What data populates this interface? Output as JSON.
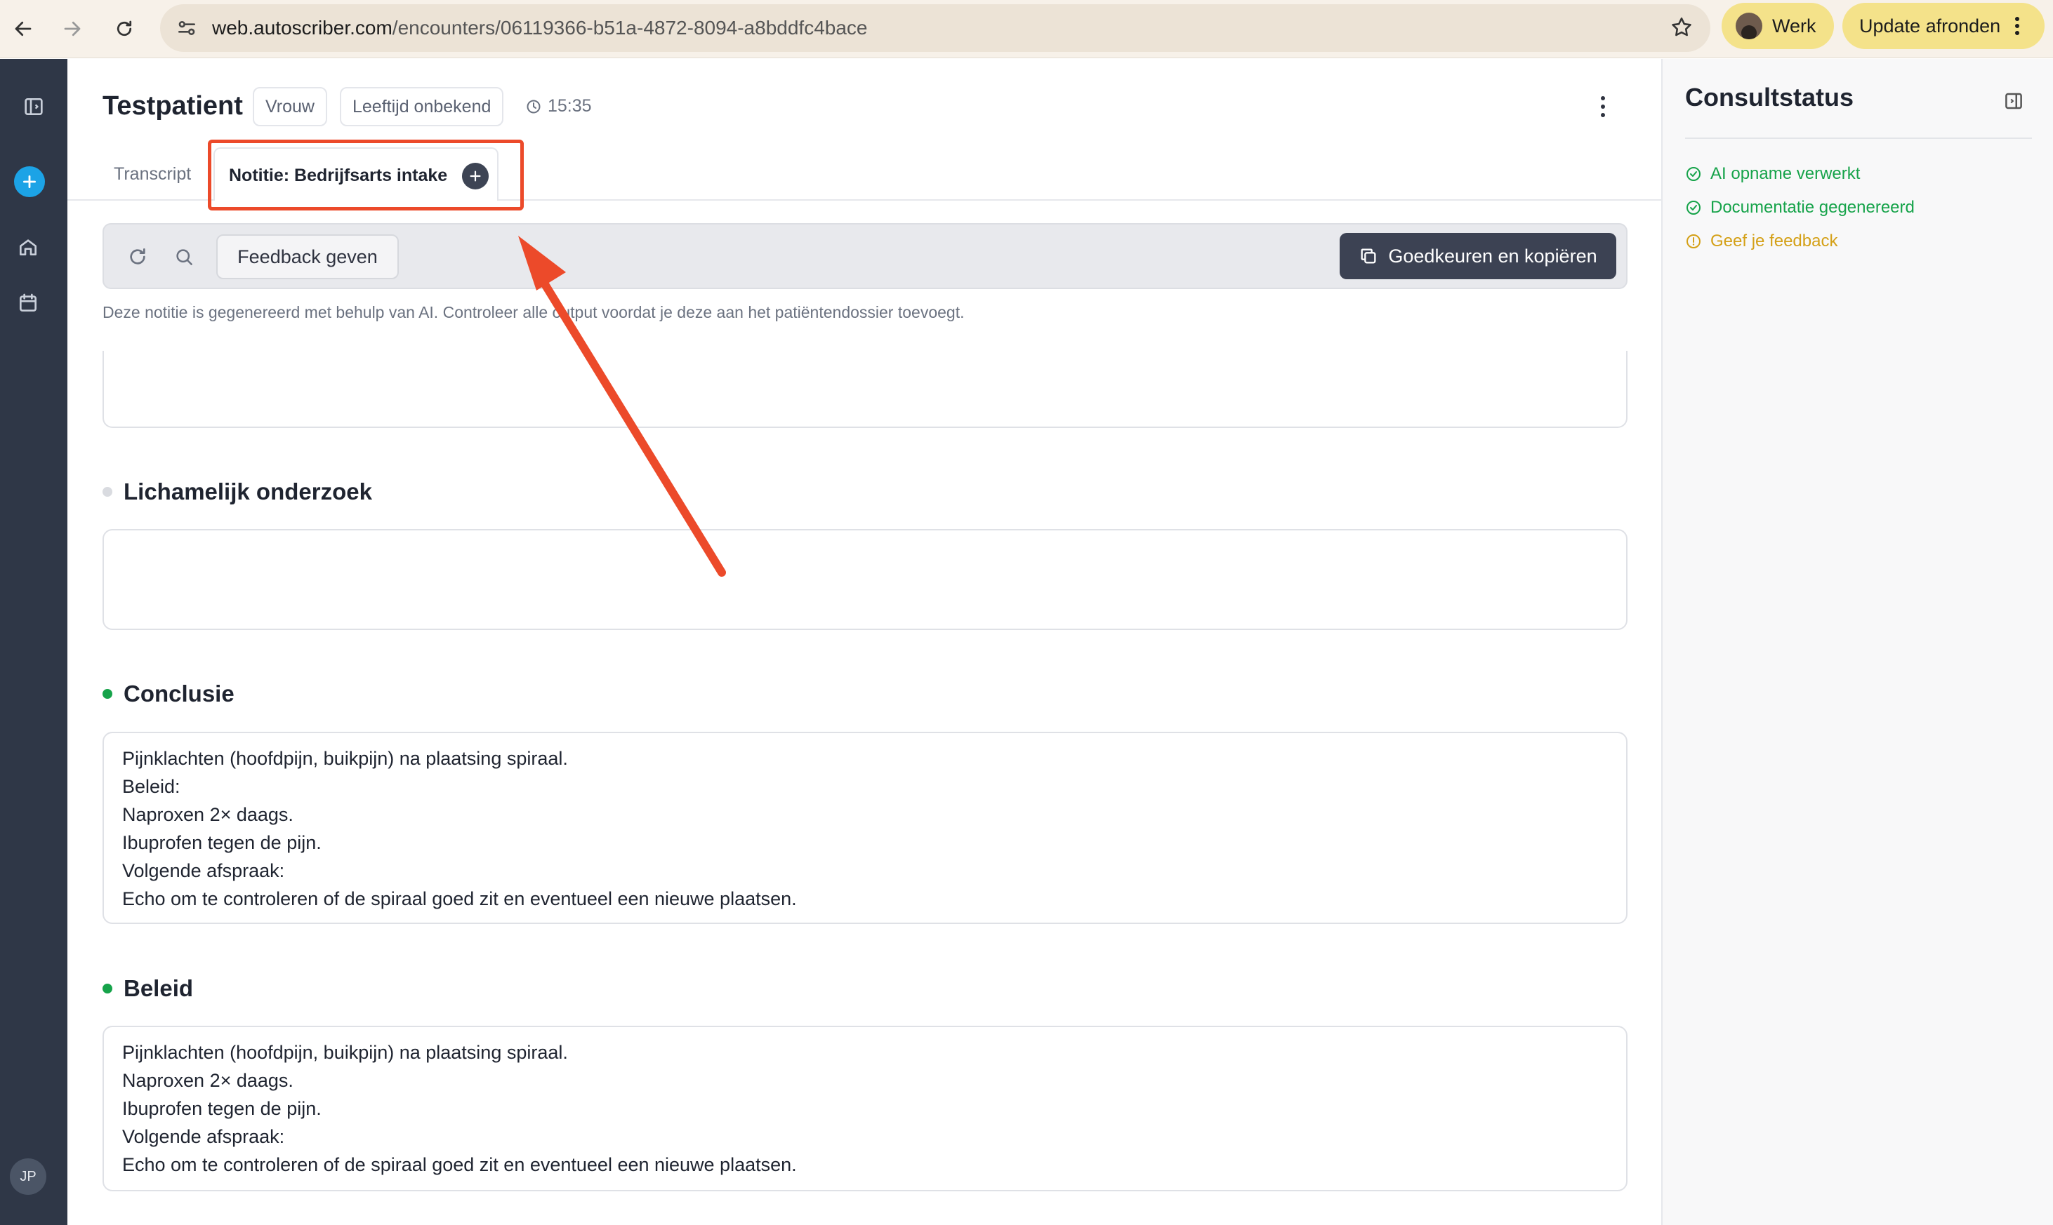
{
  "browser": {
    "url_host": "web.autoscriber.com",
    "url_path": "/encounters/06119366-b51a-4872-8094-a8bddfc4bace",
    "profile_label": "Werk",
    "update_label": "Update afronden"
  },
  "sidebar": {
    "avatar_initials": "JP"
  },
  "header": {
    "patient_name": "Testpatient",
    "gender_badge": "Vrouw",
    "age_badge": "Leeftijd onbekend",
    "time": "15:35"
  },
  "tabs": {
    "transcript": "Transcript",
    "note": "Notitie: Bedrijfsarts intake"
  },
  "toolbar": {
    "feedback_label": "Feedback geven",
    "approve_label": "Goedkeuren en kopiëren",
    "disclaimer": "Deze notitie is gegenereerd met behulp van AI. Controleer alle output voordat je deze aan het patiëntendossier toevoegt."
  },
  "sections": [
    {
      "title": "Lichamelijk onderzoek",
      "status": "empty",
      "content": ""
    },
    {
      "title": "Conclusie",
      "status": "filled",
      "content": "Pijnklachten (hoofdpijn, buikpijn) na plaatsing spiraal.\nBeleid:\nNaproxen 2× daags.\nIbuprofen tegen de pijn.\nVolgende afspraak:\nEcho om te controleren of de spiraal goed zit en eventueel een nieuwe plaatsen."
    },
    {
      "title": "Beleid",
      "status": "filled",
      "content": "Pijnklachten (hoofdpijn, buikpijn) na plaatsing spiraal.\nNaproxen 2× daags.\nIbuprofen tegen de pijn.\nVolgende afspraak:\nEcho om te controleren of de spiraal goed zit en eventueel een nieuwe plaatsen."
    }
  ],
  "consult_status": {
    "title": "Consultstatus",
    "items": [
      {
        "label": "AI opname verwerkt",
        "state": "done"
      },
      {
        "label": "Documentatie gegenereerd",
        "state": "done"
      },
      {
        "label": "Geef je feedback",
        "state": "pending"
      }
    ]
  },
  "colors": {
    "done": "#16a34a",
    "pending": "#d4a017",
    "accent": "#1ca3e6",
    "annotation": "#ec4a2a"
  }
}
